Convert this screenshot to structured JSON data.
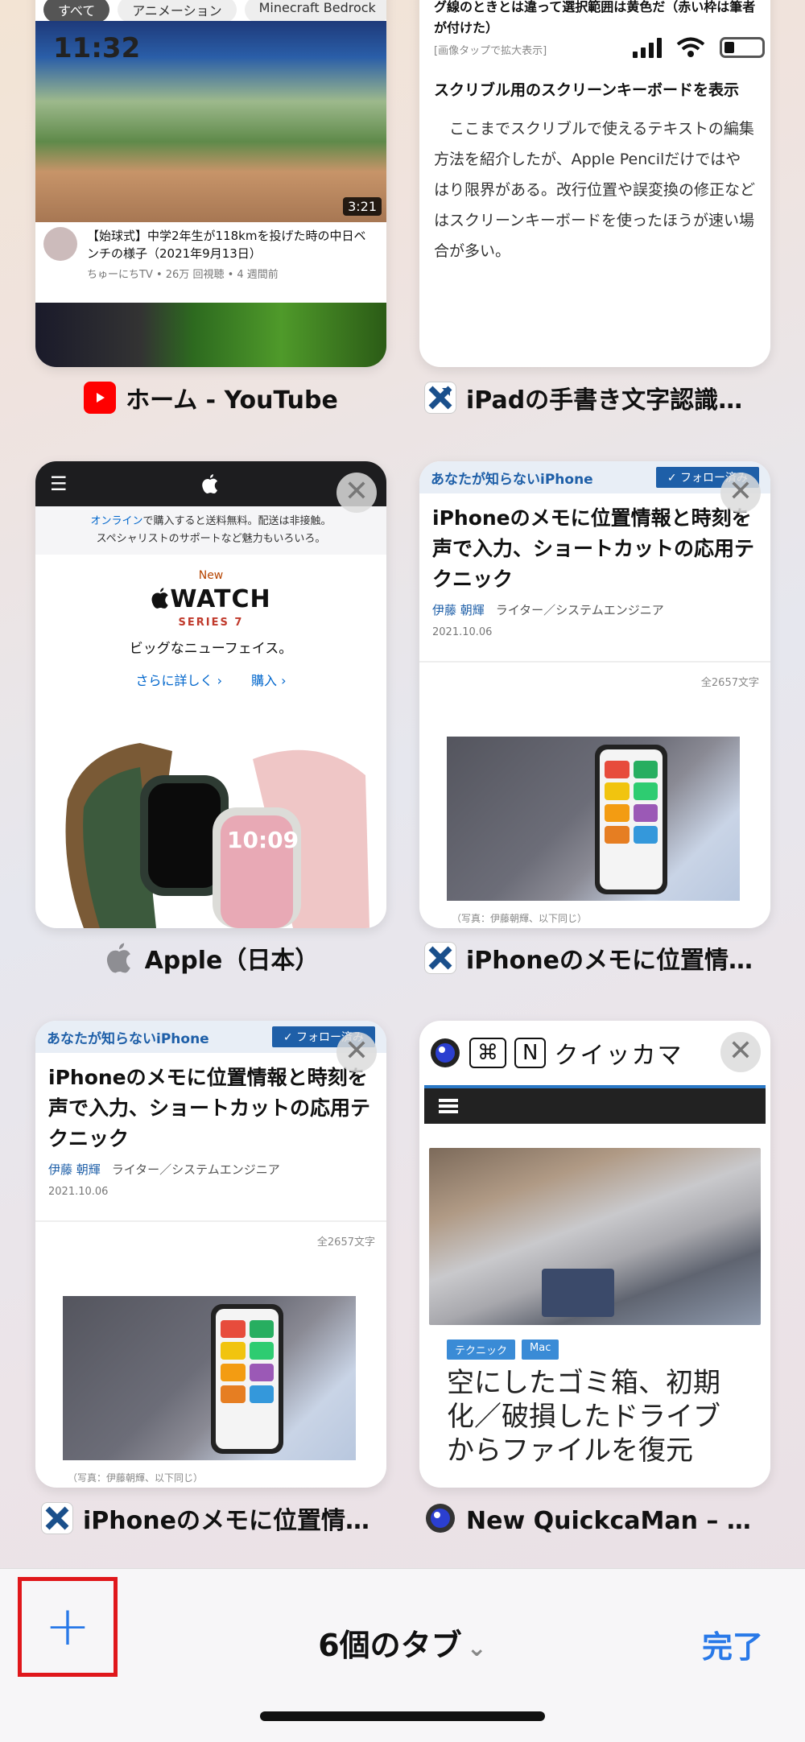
{
  "status_bar": {
    "time": "11:32"
  },
  "tabs": [
    {
      "id": "youtube",
      "label": "ホーム - YouTube",
      "favicon": "youtube-icon",
      "chips": [
        "すべて",
        "アニメーション",
        "Minecraft Bedrock"
      ],
      "video_duration": "3:21",
      "video_title": "【始球式】中学2年生が118kmを投げた時の中日ベンチの様子（2021年9月13日）",
      "video_meta": "ちゅーにちTV • 26万 回視聴 • 4 週間前"
    },
    {
      "id": "ipad-handwriting",
      "label": "iPadの手書き文字認識「…",
      "favicon": "x-logo-icon",
      "caption": "テキストを丸で囲むか下線を引くと選択される。ジグザグ線のときとは違って選択範囲は黄色だ（赤い枠は筆者が付けた）",
      "caption_note": "[画像タップで拡大表示]",
      "heading": "スクリブル用のスクリーンキーボードを表示",
      "body": "ここまでスクリブルで使えるテキストの編集方法を紹介したが、Apple Pencilだけではやはり限界がある。改行位置や誤変換の修正などはスクリーンキーボードを使ったほうが速い場合が多い。"
    },
    {
      "id": "apple",
      "label": "Apple（日本）",
      "favicon": "apple-logo-icon",
      "banner_link": "オンライン",
      "banner_rest": "で購入すると送料無料。配送は非接触。",
      "banner_line2": "スペシャリストのサポートなど魅力もいろいろ。",
      "new_label": "New",
      "product": "WATCH",
      "series": "SERIES 7",
      "tagline": "ビッグなニューフェイス。",
      "link_more": "さらに詳しく ›",
      "link_buy": "購入 ›",
      "watch_time": "10:09"
    },
    {
      "id": "iphone-memo-1",
      "label": "iPhoneのメモに位置情報…",
      "favicon": "x-logo-icon",
      "category": "あなたが知らないiPhone",
      "follow": "✓ フォロー済み",
      "title": "iPhoneのメモに位置情報と時刻を声で入力、ショートカットの応用テクニック",
      "author_name": "伊藤 朝輝",
      "author_role": "ライター／システムエンジニア",
      "date": "2021.10.06",
      "char_count": "全2657文字",
      "photo_caption": "（写真：伊藤朝輝、以下同じ）"
    },
    {
      "id": "iphone-memo-2",
      "label": "iPhoneのメモに位置情報…",
      "favicon": "x-logo-icon",
      "category": "あなたが知らないiPhone",
      "follow": "✓ フォロー済み",
      "title": "iPhoneのメモに位置情報と時刻を声で入力、ショートカットの応用テクニック",
      "author_name": "伊藤 朝輝",
      "author_role": "ライター／システムエンジニア",
      "date": "2021.10.06",
      "char_count": "全2657文字",
      "photo_caption": "（写真：伊藤朝輝、以下同じ）"
    },
    {
      "id": "quickcaman",
      "label": "New QuickcaMan – 帰っ…",
      "favicon": "quickcaman-icon",
      "key1": "⌘",
      "key2": "N",
      "site_title": "クイッカマ",
      "tags": [
        "テクニック",
        "Mac"
      ],
      "headline": "空にしたゴミ箱、初期化／破損したドライブからファイルを復元"
    }
  ],
  "toolbar": {
    "new_tab": "+",
    "tab_count": "6個のタブ",
    "chevron": "⌄",
    "done": "完了"
  },
  "close_glyph": "✕"
}
